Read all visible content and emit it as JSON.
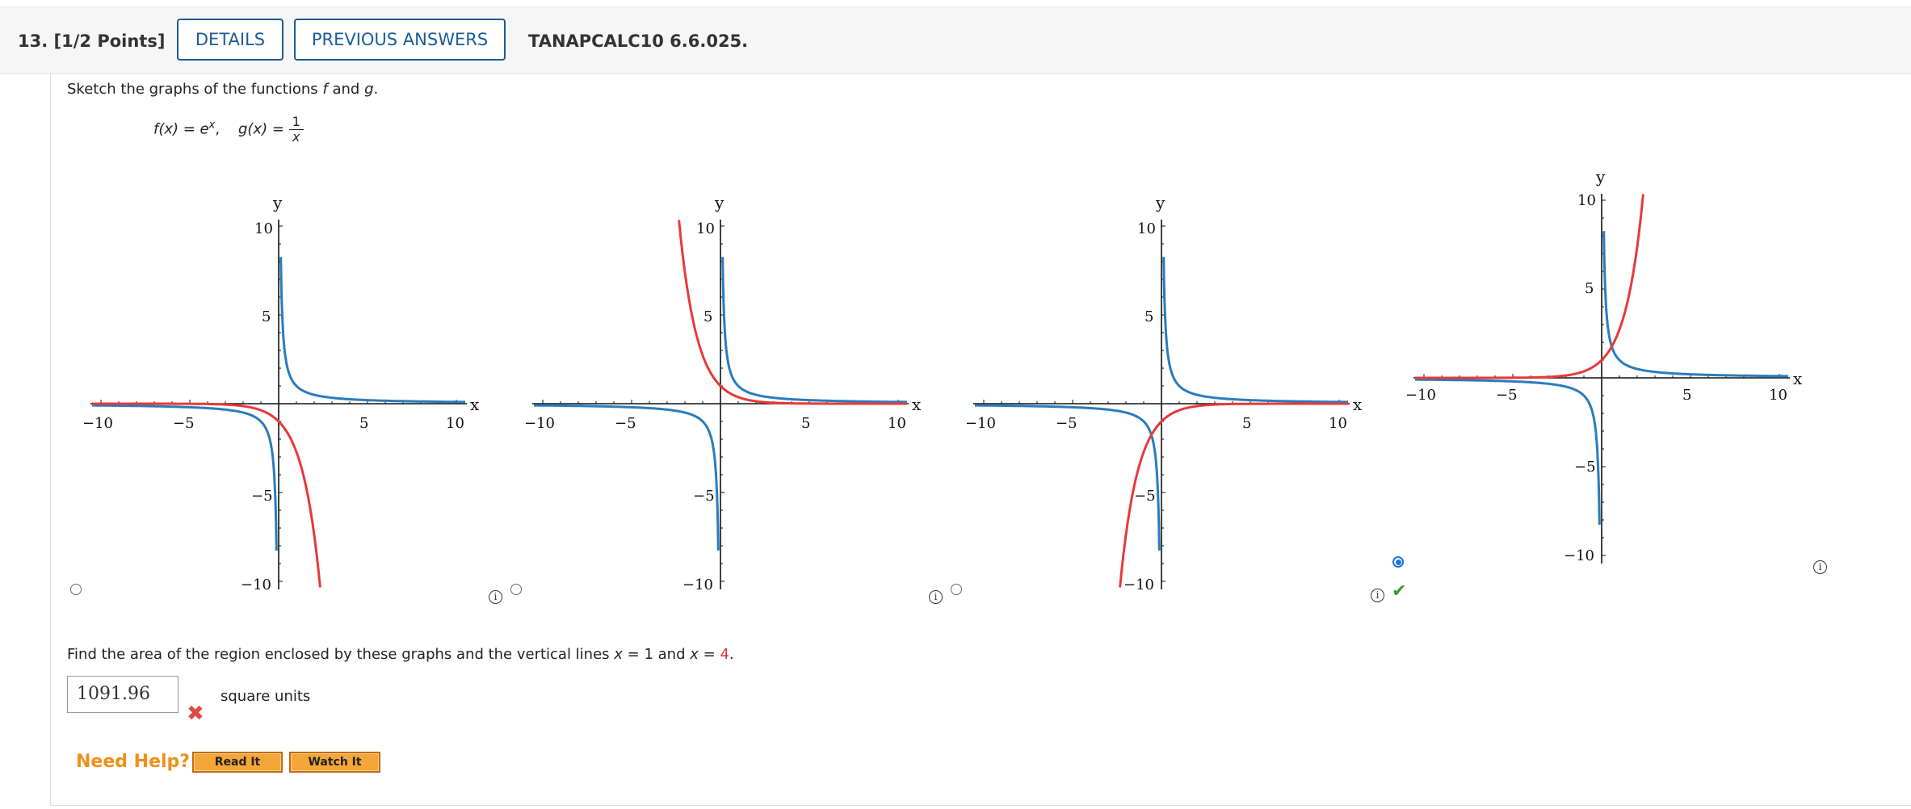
{
  "header": {
    "question_number": "13.",
    "points": "[1/2 Points]",
    "details_button": "DETAILS",
    "previous_answers_button": "PREVIOUS ANSWERS",
    "problem_code": "TANAPCALC10 6.6.025."
  },
  "prompt": {
    "intro": "Sketch the graphs of the functions",
    "f_name": "f",
    "and_word": "and",
    "g_name": "g",
    "period": ".",
    "f_def": "f(x) = e",
    "f_exp": "x",
    "sep": ",",
    "g_def": "g(x) =",
    "g_num": "1",
    "g_den": "x"
  },
  "graphs": {
    "axis_x_label": "x",
    "axis_y_label": "y",
    "f_color": "#e8383a",
    "g_color": "#2b7bbd",
    "ticks": {
      "neg10": "−10",
      "neg5": "−5",
      "pos5": "5",
      "pos10": "10"
    },
    "options": [
      {
        "f_variant": "-e^x",
        "selected": false
      },
      {
        "f_variant": "e^(-x)",
        "selected": false
      },
      {
        "f_variant": "-e^(-x)",
        "selected": false
      },
      {
        "f_variant": "e^x",
        "selected": true
      }
    ],
    "info_glyph": "i",
    "check_glyph": "✔"
  },
  "area_question": {
    "lead": "Find the area of the region enclosed by these graphs and the vertical lines",
    "x_var": "x",
    "eq": "= 1 and",
    "eq2": "=",
    "value": "4",
    "end": "."
  },
  "answer": {
    "value": "1091.96",
    "units": "square units",
    "x_glyph": "✖"
  },
  "help": {
    "label": "Need Help?",
    "read_it": "Read It",
    "watch_it": "Watch It"
  }
}
